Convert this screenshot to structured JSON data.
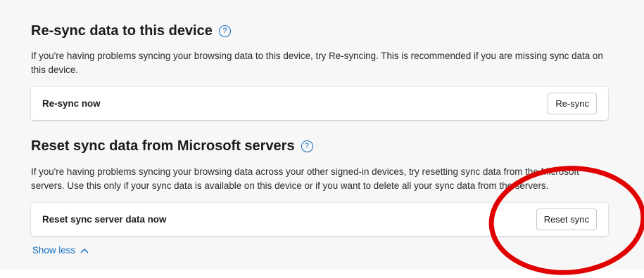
{
  "resync_section": {
    "title": "Re-sync data to this device",
    "description": "If you're having problems syncing your browsing data to this device, try Re-syncing. This is recommended if you are missing sync data on this device.",
    "card_label": "Re-sync now",
    "button_label": "Re-sync",
    "help_icon": "?"
  },
  "reset_section": {
    "title": "Reset sync data from Microsoft servers",
    "description": "If you're having problems syncing your browsing data across your other signed-in devices, try resetting sync data from the Microsoft servers. Use this only if your sync data is available on this device or if you want to delete all your sync data from the servers.",
    "card_label": "Reset sync server data now",
    "button_label": "Reset sync",
    "help_icon": "?"
  },
  "show_less": {
    "label": "Show less",
    "icon": "chevron-up-icon"
  },
  "colors": {
    "accent": "#0f6cbd",
    "annotation": "#e00000"
  }
}
